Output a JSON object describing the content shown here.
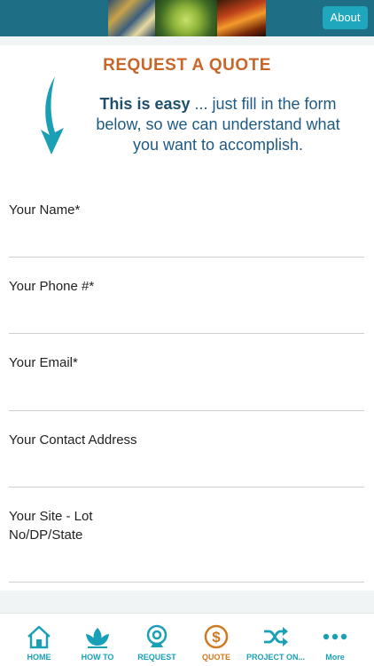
{
  "header": {
    "about_label": "About"
  },
  "page": {
    "title": "REQUEST A QUOTE",
    "intro_bold": "This is easy",
    "intro_rest": " ... just fill in the form below, so we can understand what you want to accomplish."
  },
  "form": {
    "fields": [
      {
        "label": "Your Name*"
      },
      {
        "label": "Your Phone #*"
      },
      {
        "label": "Your Email*"
      },
      {
        "label": "Your Contact Address"
      },
      {
        "label": "Your Site - Lot No/DP/State"
      }
    ]
  },
  "tabbar": {
    "tabs": [
      {
        "label": "HOME",
        "icon": "home-icon"
      },
      {
        "label": "HOW TO",
        "icon": "lotus-icon"
      },
      {
        "label": "REQUEST",
        "icon": "webcam-icon"
      },
      {
        "label": "QUOTE",
        "icon": "dollar-icon"
      },
      {
        "label": "PROJECT ON...",
        "icon": "shuffle-icon"
      },
      {
        "label": "More",
        "icon": "more-dots-icon"
      }
    ]
  },
  "colors": {
    "header_bg": "#1e6e86",
    "accent": "#1fa8bd",
    "title_orange": "#c8662a",
    "active_tab": "#cf7a22"
  }
}
